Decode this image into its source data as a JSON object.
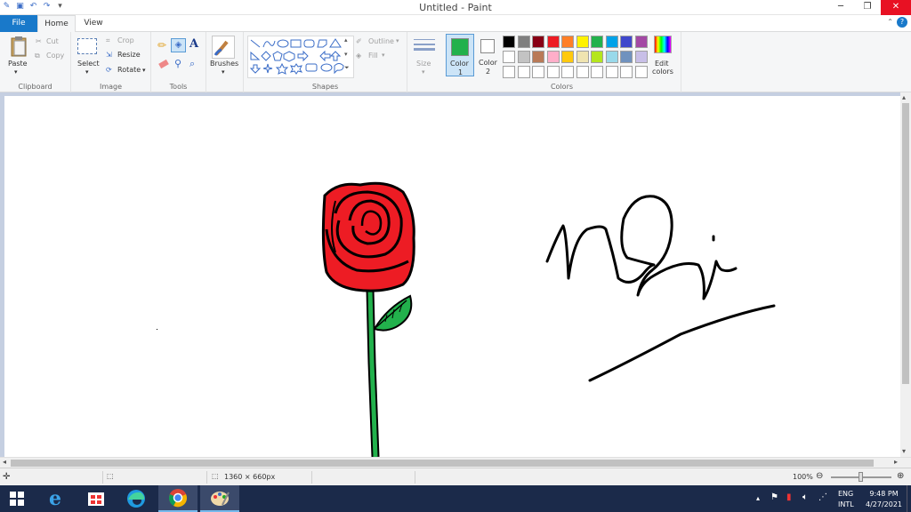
{
  "window": {
    "title": "Untitled - Paint"
  },
  "tabs": {
    "file": "File",
    "home": "Home",
    "view": "View"
  },
  "clipboard": {
    "paste": "Paste",
    "cut": "Cut",
    "copy": "Copy",
    "group": "Clipboard"
  },
  "image": {
    "select": "Select",
    "crop": "Crop",
    "resize": "Resize",
    "rotate": "Rotate",
    "group": "Image"
  },
  "tools": {
    "group": "Tools",
    "text_tool": "A"
  },
  "brushes": {
    "label": "Brushes"
  },
  "shapes": {
    "outline": "Outline",
    "fill": "Fill",
    "group": "Shapes"
  },
  "size": {
    "label": "Size"
  },
  "colors": {
    "color1_label": "Color",
    "color1_num": "1",
    "color2_label": "Color",
    "color2_num": "2",
    "edit_label": "Edit",
    "edit_label2": "colors",
    "group": "Colors",
    "color1": "#22b14c",
    "color2": "#ffffff",
    "row1": [
      "#000000",
      "#7f7f7f",
      "#880015",
      "#ed1c24",
      "#ff7f27",
      "#fff200",
      "#22b14c",
      "#00a2e8",
      "#3f48cc",
      "#a349a4"
    ],
    "row2": [
      "#ffffff",
      "#c3c3c3",
      "#b97a57",
      "#ffaec9",
      "#ffc90e",
      "#efe4b0",
      "#b5e61d",
      "#99d9ea",
      "#7092be",
      "#c8bfe7"
    ],
    "row3": [
      "#ffffff",
      "#ffffff",
      "#ffffff",
      "#ffffff",
      "#ffffff",
      "#ffffff",
      "#ffffff",
      "#ffffff",
      "#ffffff",
      "#ffffff"
    ]
  },
  "status": {
    "dimensions": "1360 × 660px",
    "zoom": "100%"
  },
  "taskbar": {
    "lang1": "ENG",
    "lang2": "INTL",
    "time": "9:48 PM",
    "date": "4/27/2021"
  }
}
